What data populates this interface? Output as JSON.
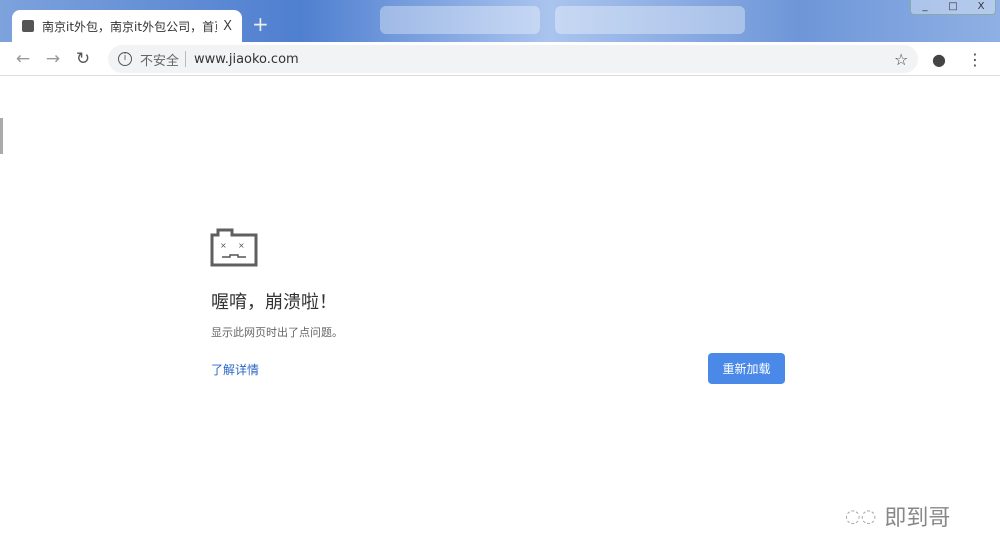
{
  "browser": {
    "tab_title": "南京it外包，南京it外包公司，首页",
    "new_tab": "+",
    "close_tab": "X",
    "window_buttons": [
      "_",
      "□",
      "X"
    ],
    "security_label": "不安全",
    "url": "www.jiaoko.com"
  },
  "error": {
    "title": "喔唷，崩溃啦！",
    "message": "显示此网页时出了点问题。",
    "learn_more": "了解详情",
    "reload": "重新加载"
  },
  "watermark": "即到哥"
}
